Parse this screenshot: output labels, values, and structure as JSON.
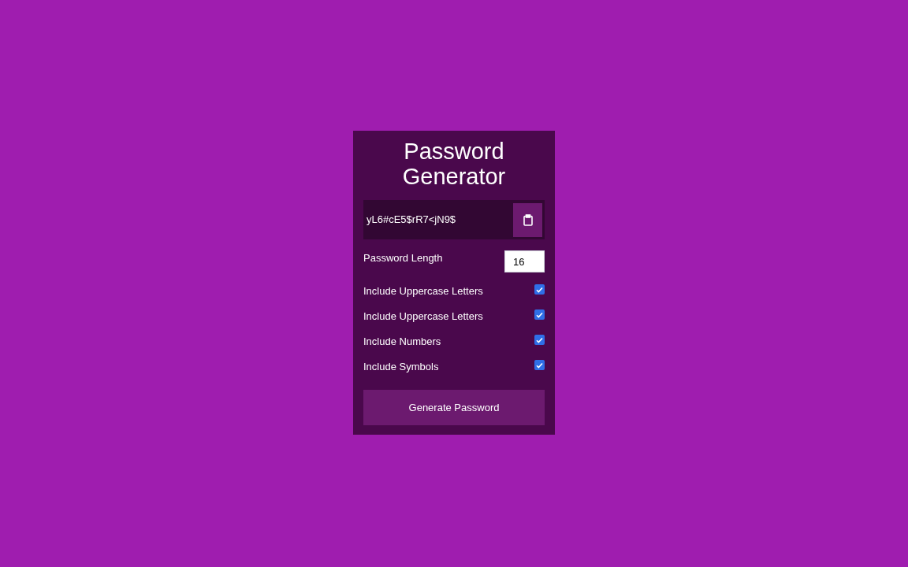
{
  "title": "Password Generator",
  "result": {
    "value": "yL6#cE5$rR7<jN9$"
  },
  "length": {
    "label": "Password Length",
    "value": "16"
  },
  "options": [
    {
      "label": "Include Uppercase Letters",
      "checked": true
    },
    {
      "label": "Include Uppercase Letters",
      "checked": true
    },
    {
      "label": "Include Numbers",
      "checked": true
    },
    {
      "label": "Include Symbols",
      "checked": true
    }
  ],
  "generate_button": "Generate Password"
}
